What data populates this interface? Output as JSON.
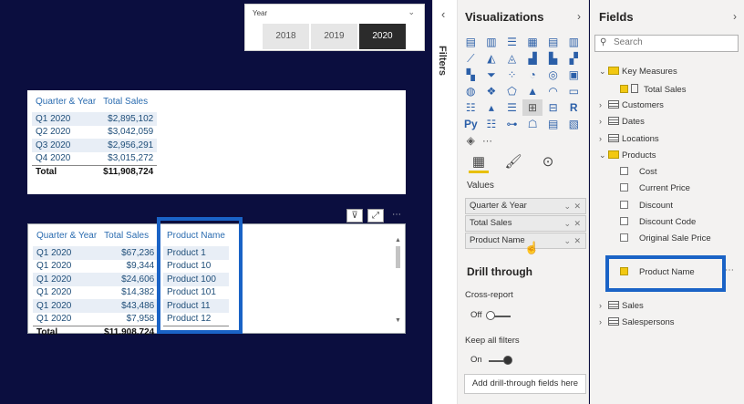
{
  "slicer": {
    "title": "Year",
    "options": [
      "2018",
      "2019",
      "2020"
    ],
    "selected": "2020"
  },
  "table1": {
    "headers": [
      "Quarter & Year",
      "Total Sales"
    ],
    "rows": [
      [
        "Q1 2020",
        "$2,895,102"
      ],
      [
        "Q2 2020",
        "$3,042,059"
      ],
      [
        "Q3 2020",
        "$2,956,291"
      ],
      [
        "Q4 2020",
        "$3,015,272"
      ]
    ],
    "total": [
      "Total",
      "$11,908,724"
    ]
  },
  "table2": {
    "headers": [
      "Quarter & Year",
      "Total Sales",
      "Product Name"
    ],
    "rows": [
      [
        "Q1 2020",
        "$67,236",
        "Product 1"
      ],
      [
        "Q1 2020",
        "$9,344",
        "Product 10"
      ],
      [
        "Q1 2020",
        "$24,606",
        "Product 100"
      ],
      [
        "Q1 2020",
        "$14,382",
        "Product 101"
      ],
      [
        "Q1 2020",
        "$43,486",
        "Product 11"
      ],
      [
        "Q1 2020",
        "$7,958",
        "Product 12"
      ]
    ],
    "total": [
      "Total",
      "$11,908,724",
      ""
    ]
  },
  "filters": {
    "label": "Filters"
  },
  "viz": {
    "title": "Visualizations",
    "values_label": "Values",
    "wells": [
      "Quarter & Year",
      "Total Sales",
      "Product Name"
    ],
    "drill_title": "Drill through",
    "cross_report": "Cross-report",
    "cross_state": "Off",
    "keep_all": "Keep all filters",
    "keep_state": "On",
    "add_button": "Add drill-through fields here"
  },
  "fields": {
    "title": "Fields",
    "search_placeholder": "Search",
    "key_measures": "Key Measures",
    "total_sales": "Total Sales",
    "customers": "Customers",
    "dates": "Dates",
    "locations": "Locations",
    "products": "Products",
    "product_fields": [
      "Cost",
      "Current Price",
      "Discount",
      "Discount Code",
      "Original Sale Price"
    ],
    "product_name": "Product Name",
    "sales": "Sales",
    "salespersons": "Salespersons"
  }
}
